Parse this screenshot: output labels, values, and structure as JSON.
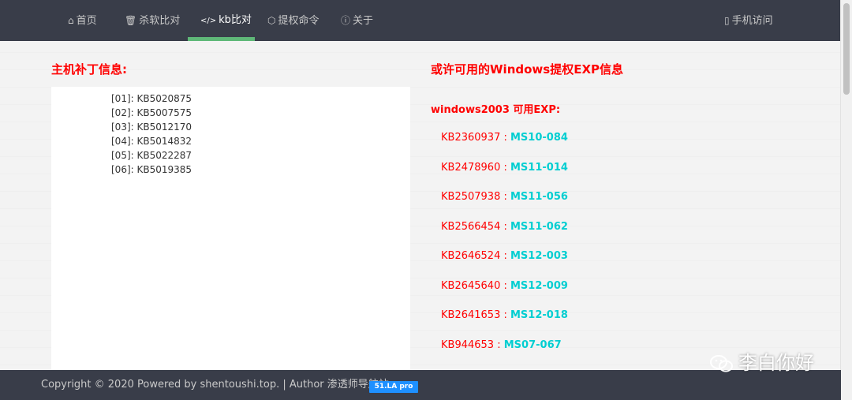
{
  "nav": {
    "items": [
      {
        "icon": "home-icon",
        "glyph": "⌂",
        "label": "首页"
      },
      {
        "icon": "trash-icon",
        "glyph": "🗑",
        "label": "杀软比对"
      },
      {
        "icon": "code-icon",
        "glyph": "</>",
        "label": "kb比对"
      },
      {
        "icon": "cube-icon",
        "glyph": "⬡",
        "label": "提权命令"
      },
      {
        "icon": "info-icon",
        "glyph": "ⓘ",
        "label": "关于"
      }
    ],
    "mobile": {
      "icon": "phone-icon",
      "glyph": "▯",
      "label": "手机访问"
    },
    "active_index": 2,
    "accent_color": "#5fb878"
  },
  "left": {
    "title": "主机补丁信息:",
    "patches": [
      "[01]: KB5020875",
      "[02]: KB5007575",
      "[03]: KB5012170",
      "[04]: KB5014832",
      "[05]: KB5022287",
      "[06]: KB5019385"
    ]
  },
  "right": {
    "title": "或许可用的Windows提权EXP信息",
    "subtitle": "windows2003 可用EXP:",
    "exps": [
      {
        "kb": "KB2360937",
        "ms": "MS10-084"
      },
      {
        "kb": "KB2478960",
        "ms": "MS11-014"
      },
      {
        "kb": "KB2507938",
        "ms": "MS11-056"
      },
      {
        "kb": "KB2566454",
        "ms": "MS11-062"
      },
      {
        "kb": "KB2646524",
        "ms": "MS12-003"
      },
      {
        "kb": "KB2645640",
        "ms": "MS12-009"
      },
      {
        "kb": "KB2641653",
        "ms": "MS12-018"
      },
      {
        "kb": "KB944653",
        "ms": "MS07-067"
      }
    ],
    "separator": " : "
  },
  "footer": {
    "text": "Copyright © 2020 Powered by shentoushi.top. | Author 渗透师导航站",
    "badge": "51.LA pro"
  },
  "watermark": {
    "text": "李白你好"
  }
}
